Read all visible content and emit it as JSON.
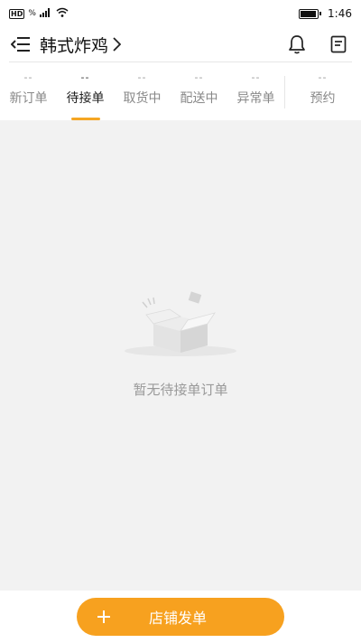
{
  "status_bar": {
    "network_label": "HD",
    "speed_label": "%",
    "time": "1:46"
  },
  "header": {
    "title": "韩式炸鸡",
    "back_icon": "menu-collapse-icon",
    "chevron_icon": "chevron-right-icon",
    "bell_icon": "bell-icon",
    "doc_icon": "document-icon"
  },
  "tabs": [
    {
      "count": "--",
      "label": "新订单"
    },
    {
      "count": "--",
      "label": "待接单"
    },
    {
      "count": "--",
      "label": "取货中"
    },
    {
      "count": "--",
      "label": "配送中"
    },
    {
      "count": "--",
      "label": "异常单"
    },
    {
      "count": "--",
      "label": "预约"
    }
  ],
  "active_tab_index": 1,
  "empty_state": {
    "icon": "empty-box-icon",
    "message": "暂无待接单订单"
  },
  "bottom_action": {
    "icon": "plus-icon",
    "label": "店铺发单"
  },
  "colors": {
    "accent": "#f7a11f",
    "background": "#f2f2f2"
  }
}
